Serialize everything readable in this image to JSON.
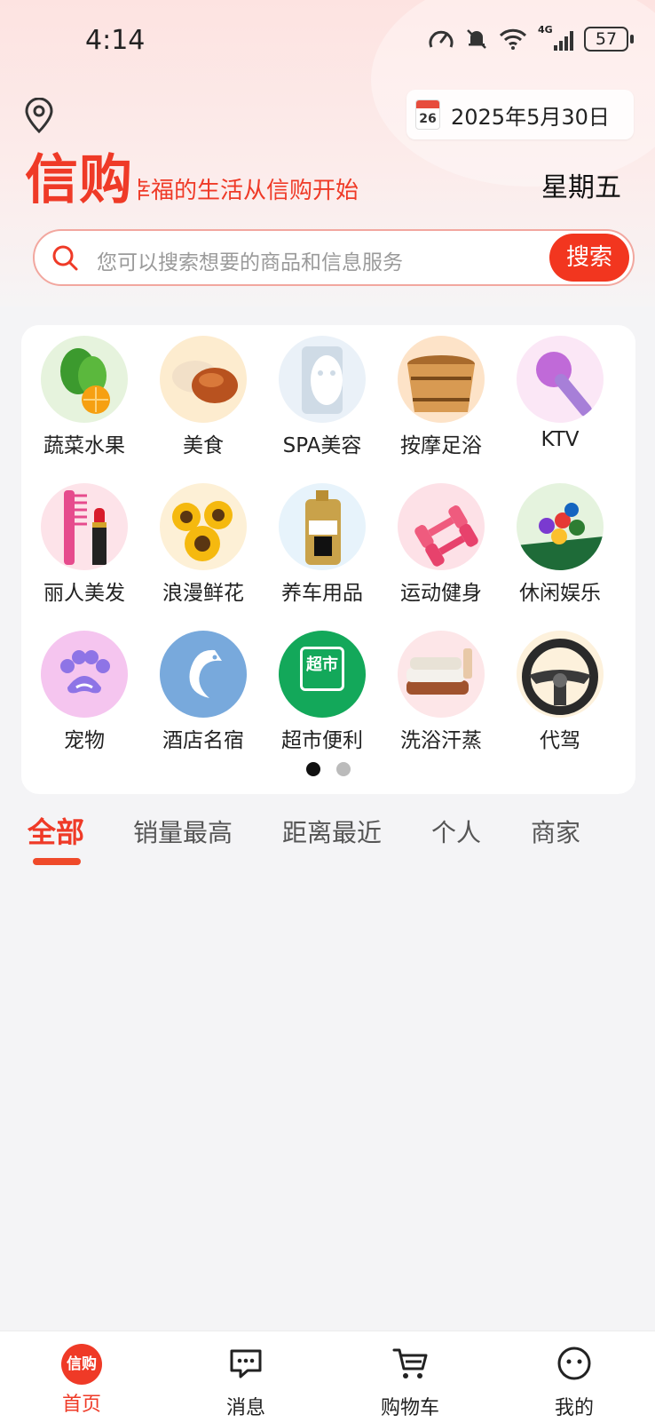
{
  "status_bar": {
    "time": "4:14",
    "network": "4G",
    "battery": "57"
  },
  "header": {
    "date": "2025年5月30日",
    "calendar_day": "26",
    "logo": "信购",
    "slogan": "幸福的生活从信购开始",
    "weekday": "星期五"
  },
  "search": {
    "placeholder": "您可以搜索想要的商品和信息服务",
    "button": "搜索"
  },
  "categories": [
    {
      "label": "蔬菜水果",
      "icon": "vegetables-fruit-icon",
      "color": "#e6f3dd"
    },
    {
      "label": "美食",
      "icon": "food-icon",
      "color": "#fdeccf"
    },
    {
      "label": "SPA美容",
      "icon": "face-mask-icon",
      "color": "#eaf1f8"
    },
    {
      "label": "按摩足浴",
      "icon": "wooden-tub-icon",
      "color": "#fde3c8"
    },
    {
      "label": "KTV",
      "icon": "microphone-icon",
      "color": "#fbe7f6"
    },
    {
      "label": "丽人美发",
      "icon": "comb-lipstick-icon",
      "color": "#fde3e9"
    },
    {
      "label": "浪漫鲜花",
      "icon": "sunflower-icon",
      "color": "#fdf0d6"
    },
    {
      "label": "养车用品",
      "icon": "motor-oil-icon",
      "color": "#e7f3fb"
    },
    {
      "label": "运动健身",
      "icon": "dumbbell-icon",
      "color": "#fde1e7"
    },
    {
      "label": "休闲娱乐",
      "icon": "billiards-icon",
      "color": "#e5f3de"
    },
    {
      "label": "宠物",
      "icon": "paw-icon",
      "color": "#f5c5ef"
    },
    {
      "label": "酒店名宿",
      "icon": "dolphin-icon",
      "color": "#78a9dc"
    },
    {
      "label": "超市便利",
      "icon": "supermarket-icon",
      "color": "#13a85a",
      "badge": "超市"
    },
    {
      "label": "洗浴汗蒸",
      "icon": "towel-icon",
      "color": "#fde6e8"
    },
    {
      "label": "代驾",
      "icon": "steering-wheel-icon",
      "color": "#fdf1dc"
    }
  ],
  "pagination": {
    "pages": 2,
    "current": 1
  },
  "tabs": [
    "全部",
    "销量最高",
    "距离最近",
    "个人",
    "商家"
  ],
  "active_tab": 0,
  "bottom_nav": [
    {
      "label": "首页",
      "icon": "home-logo-icon",
      "badge": "信购",
      "active": true
    },
    {
      "label": "消息",
      "icon": "message-icon",
      "active": false
    },
    {
      "label": "购物车",
      "icon": "cart-icon",
      "active": false
    },
    {
      "label": "我的",
      "icon": "profile-icon",
      "active": false
    }
  ],
  "colors": {
    "brand": "#ef3a27",
    "search_button": "#f2361f",
    "search_border": "#f2a79f"
  }
}
